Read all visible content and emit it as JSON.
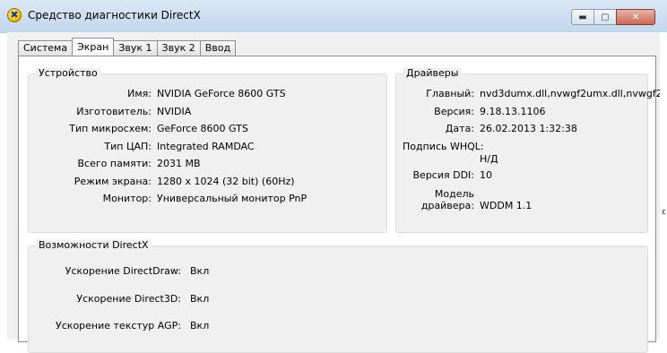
{
  "window": {
    "title": "Средство диагностики DirectX",
    "icon_glyph": "✖",
    "controls": {
      "minimize": "▬",
      "maximize": "▢",
      "close": "✕"
    }
  },
  "tabs": [
    {
      "label": "Система",
      "active": false
    },
    {
      "label": "Экран",
      "active": true
    },
    {
      "label": "Звук 1",
      "active": false
    },
    {
      "label": "Звук 2",
      "active": false
    },
    {
      "label": "Ввод",
      "active": false
    }
  ],
  "device": {
    "title": "Устройство",
    "rows": [
      {
        "label": "Имя:",
        "value": "NVIDIA GeForce 8600 GTS"
      },
      {
        "label": "Изготовитель:",
        "value": "NVIDIA"
      },
      {
        "label": "Тип микросхем:",
        "value": "GeForce 8600 GTS"
      },
      {
        "label": "Тип ЦАП:",
        "value": "Integrated RAMDAC"
      },
      {
        "label": "Всего памяти:",
        "value": "2031 MB"
      },
      {
        "label": "Режим экрана:",
        "value": "1280 x 1024 (32 bit) (60Hz)"
      },
      {
        "label": "Монитор:",
        "value": "Универсальный монитор PnP"
      }
    ]
  },
  "drivers": {
    "title": "Драйверы",
    "main": {
      "label": "Главный:",
      "value": "nvd3dumx.dll,nvwgf2umx.dll,nvwgf2"
    },
    "version": {
      "label": "Версия:",
      "value": "9.18.13.1106"
    },
    "date": {
      "label": "Дата:",
      "value": "26.02.2013 1:32:38"
    },
    "whql": {
      "label": "Подпись WHQL:",
      "value": "Н/Д"
    },
    "ddi": {
      "label": "Версия DDI:",
      "value": "10"
    },
    "model": {
      "label_line1": "Модель",
      "label_line2": "драйвера:",
      "value": "WDDM 1.1"
    }
  },
  "directx": {
    "title": "Возможности DirectX",
    "rows": [
      {
        "label": "Ускорение DirectDraw:",
        "value": "Вкл"
      },
      {
        "label": "Ускорение Direct3D:",
        "value": "Вкл"
      },
      {
        "label": "Ускорение текстур AGP:",
        "value": "Вкл"
      }
    ]
  },
  "edge_mark": "ε"
}
